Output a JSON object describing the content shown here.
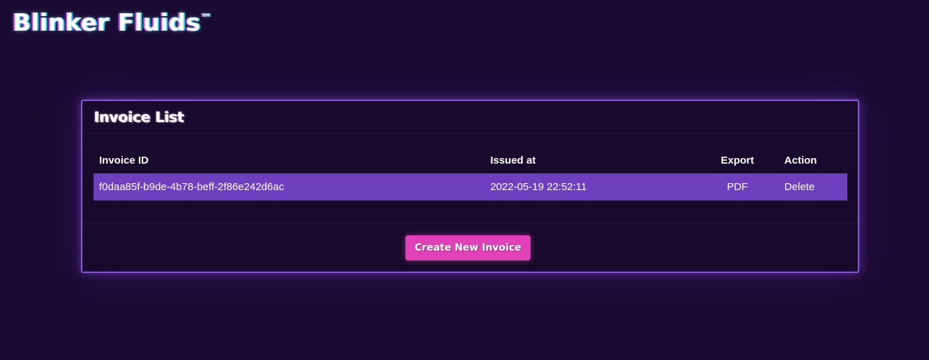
{
  "brand": {
    "name": "Blinker Fluids",
    "trademark": "™"
  },
  "panel": {
    "title": "Invoice List"
  },
  "table": {
    "headers": {
      "id": "Invoice ID",
      "issued": "Issued at",
      "export": "Export",
      "action": "Action"
    },
    "rows": [
      {
        "id": "f0daa85f-b9de-4b78-beff-2f86e242d6ac",
        "issued": "2022-05-19 22:52:11",
        "export": "PDF",
        "action": "Delete"
      }
    ]
  },
  "footer": {
    "create_label": "Create New Invoice"
  },
  "colors": {
    "background": "#1b0b33",
    "panel_border": "#8a55e0",
    "row_highlight": "#6e40c0",
    "button": "#e040b8"
  }
}
